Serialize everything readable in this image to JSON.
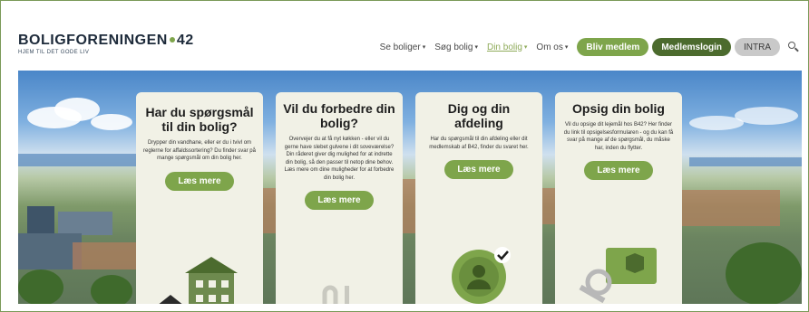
{
  "header": {
    "logo": {
      "name": "BOLIGFORENINGEN",
      "number": "42",
      "tagline": "HJEM TIL DET GODE LIV"
    },
    "nav": [
      {
        "label": "Se boliger",
        "has_dropdown": true,
        "active": false
      },
      {
        "label": "Søg bolig",
        "has_dropdown": true,
        "active": false
      },
      {
        "label": "Din bolig",
        "has_dropdown": true,
        "active": true
      },
      {
        "label": "Om os",
        "has_dropdown": true,
        "active": false
      }
    ],
    "buttons": {
      "member": "Bliv medlem",
      "login": "Medlemslogin",
      "intra": "INTRA"
    },
    "search_icon": "search-icon"
  },
  "cards": [
    {
      "title": "Har du spørgsmål til din bolig?",
      "text": "Drypper din vandhane, eller er du i tvivl om reglerne for affaldssortering? Du finder svar på mange spørgsmål om din bolig her.",
      "button": "Læs mere",
      "icon": "house-icon"
    },
    {
      "title": "Vil du forbedre din bolig?",
      "text": "Overvejer du at få nyt køkken - eller vil du gerne have slebet gulvene i dit soveværelse? Din råderet giver dig mulighed for at indrette din bolig, så den passer til netop dine behov. Læs mere om dine muligheder for at forbedre din bolig her.",
      "button": "Læs mere",
      "icon": "tools-icon"
    },
    {
      "title": "Dig og din afdeling",
      "text": "Har du spørgsmål til din afdeling eller dit medlemskab af B42, finder du svaret her.",
      "button": "Læs mere",
      "icon": "member-check-icon"
    },
    {
      "title": "Opsig din bolig",
      "text": "Vil du opsige dit lejemål hos B42? Her finder du link til opsigelsesformularen - og du kan få svar på mange af de spørgsmål, du måske har, inden du flytter.",
      "button": "Læs mere",
      "icon": "key-icon"
    }
  ],
  "colors": {
    "accent_green": "#7ea54b",
    "dark_green": "#4c6b2e",
    "card_bg": "#f1f1e6",
    "logo_navy": "#1d2a3a"
  }
}
